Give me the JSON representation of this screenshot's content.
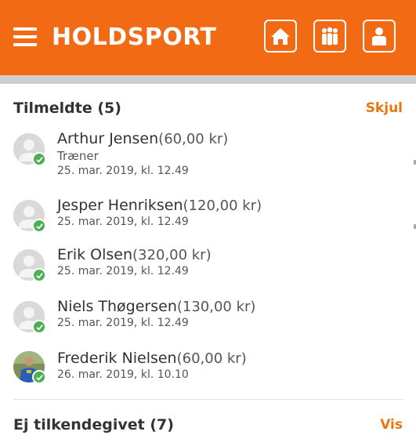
{
  "header": {
    "logo_text": "HOLDSPORT",
    "brand_color": "#f26a13",
    "nav_icons": [
      "home-icon",
      "team-icon",
      "profile-icon"
    ]
  },
  "registered": {
    "title": "Tilmeldte (5)",
    "action": "Skjul",
    "members": [
      {
        "name": "Arthur Jensen",
        "amount": "(60,00 kr)",
        "role": "Træner",
        "date": "25. mar. 2019, kl. 12.49",
        "avatar": "placeholder"
      },
      {
        "name": "Jesper Henriksen",
        "amount": "(120,00 kr)",
        "role": "",
        "date": "25. mar. 2019, kl. 12.49",
        "avatar": "placeholder"
      },
      {
        "name": "Erik Olsen",
        "amount": "(320,00 kr)",
        "role": "",
        "date": "25. mar. 2019, kl. 12.49",
        "avatar": "placeholder"
      },
      {
        "name": "Niels Thøgersen",
        "amount": "(130,00 kr)",
        "role": "",
        "date": "25. mar. 2019, kl. 12.49",
        "avatar": "placeholder"
      },
      {
        "name": "Frederik Nielsen",
        "amount": "(60,00 kr)",
        "role": "",
        "date": "26. mar. 2019, kl. 10.10",
        "avatar": "photo"
      }
    ]
  },
  "unanswered": {
    "title": "Ej tilkendegivet (7)",
    "action": "Vis"
  }
}
